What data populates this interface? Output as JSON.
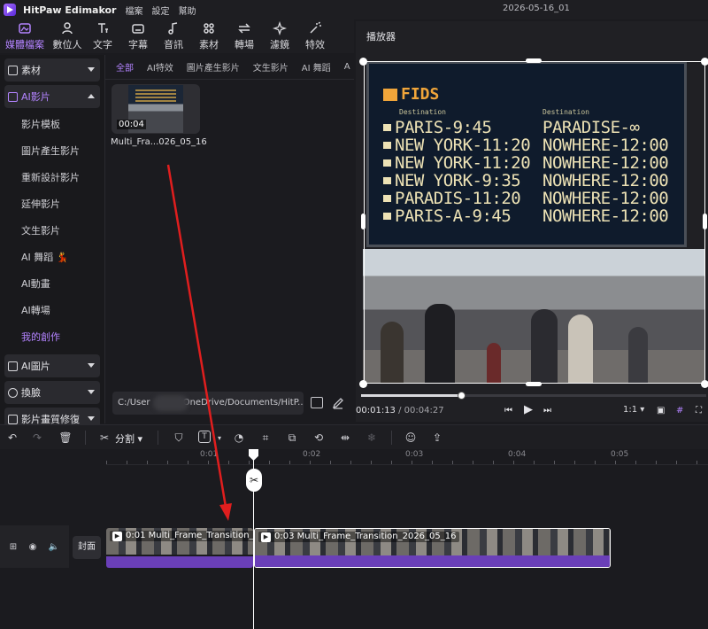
{
  "app": {
    "name": "HitPaw Edimakor",
    "menu": [
      "檔案",
      "設定",
      "幫助"
    ],
    "project_title": "2026-05-16_01"
  },
  "toolbar": {
    "items": [
      {
        "label": "媒體檔案",
        "icon": "media-icon"
      },
      {
        "label": "數位人",
        "icon": "avatar-icon"
      },
      {
        "label": "文字",
        "icon": "text-icon"
      },
      {
        "label": "字幕",
        "icon": "subtitle-icon"
      },
      {
        "label": "音訊",
        "icon": "audio-icon"
      },
      {
        "label": "素材",
        "icon": "assets-icon"
      },
      {
        "label": "轉場",
        "icon": "transition-icon"
      },
      {
        "label": "濾鏡",
        "icon": "filter-icon"
      },
      {
        "label": "特效",
        "icon": "effects-icon"
      }
    ]
  },
  "sidebar": {
    "group_material": "素材",
    "group_ai_video": "AI影片",
    "sub_items": [
      "影片模板",
      "圖片產生影片",
      "重新設計影片",
      "延伸影片",
      "文生影片",
      "AI 舞蹈 💃",
      "AI動畫",
      "AI轉場",
      "我的創作"
    ],
    "group_ai_image": "AI圖片",
    "group_face_swap": "換臉",
    "group_restore": "影片畫質修復"
  },
  "media": {
    "tabs": [
      "全部",
      "AI特效",
      "圖片產生影片",
      "文生影片",
      "AI 舞蹈",
      "A"
    ],
    "clip_duration": "00:04",
    "clip_name": "Multi_Fra...026_05_16",
    "path_left": "C:/User",
    "path_right": "OneDrive/Documents/HitP..."
  },
  "player": {
    "header": "播放器",
    "current_time": "00:01:13",
    "total_time": "/ 00:04:27",
    "ratio": "1:1",
    "progress": 0.29,
    "board": {
      "logo": "FIDS",
      "subheads": [
        "Destination",
        "Destination"
      ],
      "rows": [
        [
          "PARIS-9:45",
          "PARADISE-∞"
        ],
        [
          "NEW YORK-11:20",
          "NOWHERE-12:00"
        ],
        [
          "NEW YORK-11:20",
          "NOWHERE-12:00"
        ],
        [
          "NEW YORK-9:35",
          "NOWHERE-12:00"
        ],
        [
          "PARADIS-11:20",
          "NOWHERE-12:00"
        ],
        [
          "PARIS-A-9:45",
          "NOWHERE-12:00"
        ]
      ]
    }
  },
  "timeline_toolbar": {
    "split_label": "分割"
  },
  "timeline": {
    "ruler_labels": [
      "0:01",
      "0:02",
      "0:03",
      "0:04",
      "0:05"
    ],
    "cover_label": "封面",
    "clip1_label": "0:01 Multi_Frame_Transition_20",
    "clip2_label": "0:03 Multi_Frame_Transition_2026_05_16"
  },
  "colors": {
    "accent": "#b383ff",
    "annotation": "#e01e1e",
    "audio": "#6a3fb8"
  }
}
